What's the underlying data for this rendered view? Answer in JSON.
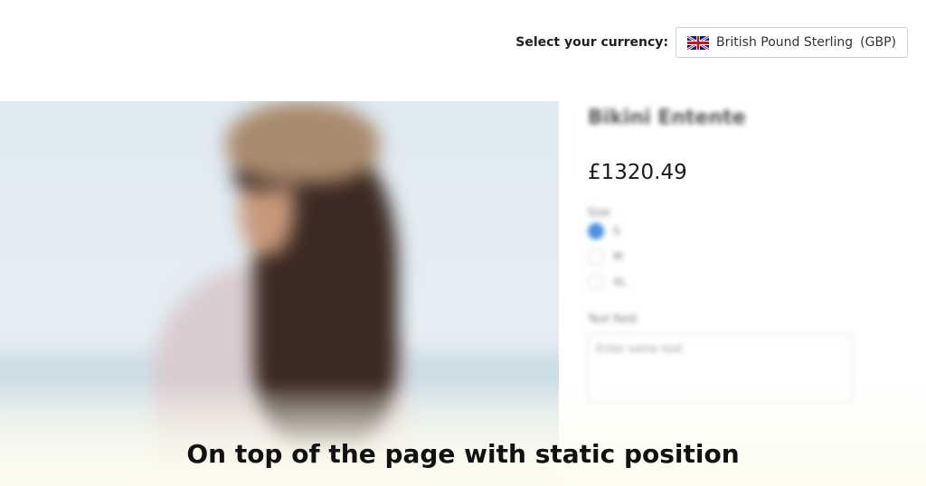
{
  "currency": {
    "label": "Select your currency:",
    "selected_name": "British Pound Sterling",
    "selected_code": "(GBP)",
    "flag_icon": "uk-flag-icon"
  },
  "product": {
    "title": "Bikini Entente",
    "price": "£1320.49",
    "size_label": "Size",
    "sizes": [
      "S",
      "M",
      "XL"
    ],
    "selected_size_index": 0,
    "text_label": "Text field",
    "text_placeholder": "Enter some text"
  },
  "caption": "On top of the page with static position"
}
